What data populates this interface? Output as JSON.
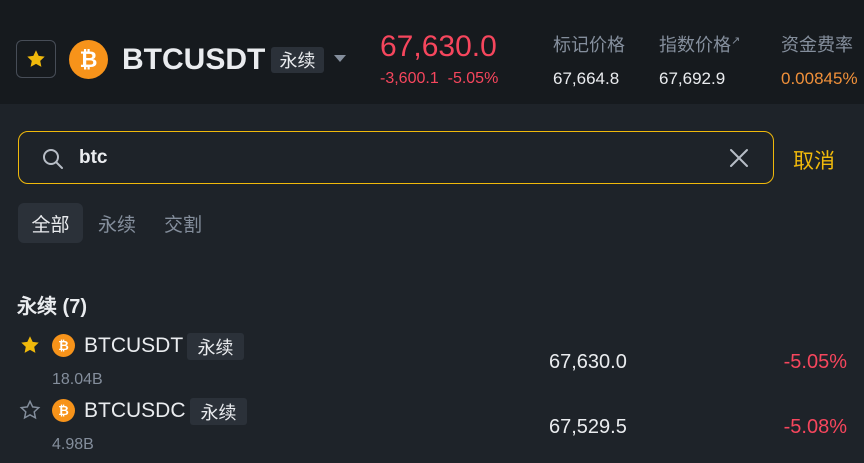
{
  "header": {
    "symbol": "BTCUSDT",
    "coin_glyph": "₿",
    "contract_tag": "永续",
    "last_price": "67,630.0",
    "change_abs": "-3,600.1",
    "change_pct": "-5.05%",
    "mark_price_label": "标记价格",
    "mark_price": "67,664.8",
    "index_price_label": "指数价格",
    "index_price_ext": "↗",
    "index_price": "67,692.9",
    "funding_label": "资金费率",
    "funding_rate": "0.00845%"
  },
  "search": {
    "value": "btc",
    "placeholder": "",
    "cancel_label": "取消"
  },
  "tabs": [
    {
      "label": "全部",
      "active": true
    },
    {
      "label": "永续",
      "active": false
    },
    {
      "label": "交割",
      "active": false
    }
  ],
  "section": {
    "title": "永续 (7)"
  },
  "rows": [
    {
      "starred": true,
      "coin_glyph": "₿",
      "symbol": "BTCUSDT",
      "tag": "永续",
      "volume": "18.04B",
      "price": "67,630.0",
      "change": "-5.05%"
    },
    {
      "starred": false,
      "coin_glyph": "₿",
      "symbol": "BTCUSDC",
      "tag": "永续",
      "volume": "4.98B",
      "price": "67,529.5",
      "change": "-5.08%"
    }
  ],
  "colors": {
    "background": "#1e2329",
    "header_bg": "#161a1e",
    "accent": "#f0b90b",
    "negative": "#f6465d",
    "btc": "#f7931a",
    "muted": "#848e9c"
  }
}
